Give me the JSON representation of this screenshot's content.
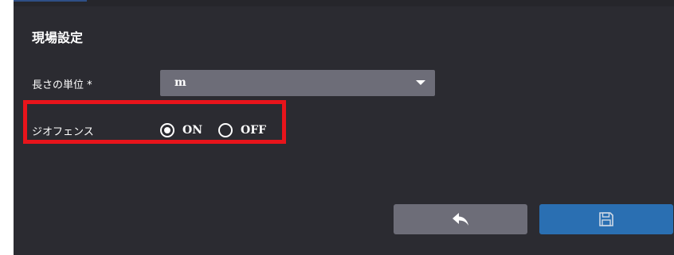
{
  "dialog": {
    "title": "現場設定",
    "length_unit": {
      "label": "長さの単位 *",
      "selected_value": "m"
    },
    "geofence": {
      "label": "ジオフェンス",
      "options": [
        {
          "label": "ON",
          "checked": true
        },
        {
          "label": "OFF",
          "checked": false
        }
      ]
    },
    "buttons": {
      "back_icon": "reply-arrow-icon",
      "save_icon": "floppy-disk-icon"
    },
    "colors": {
      "background": "#2b2b31",
      "select_bg": "#6d6d78",
      "save_button": "#2a6fb2",
      "highlight": "#e8141b"
    }
  }
}
